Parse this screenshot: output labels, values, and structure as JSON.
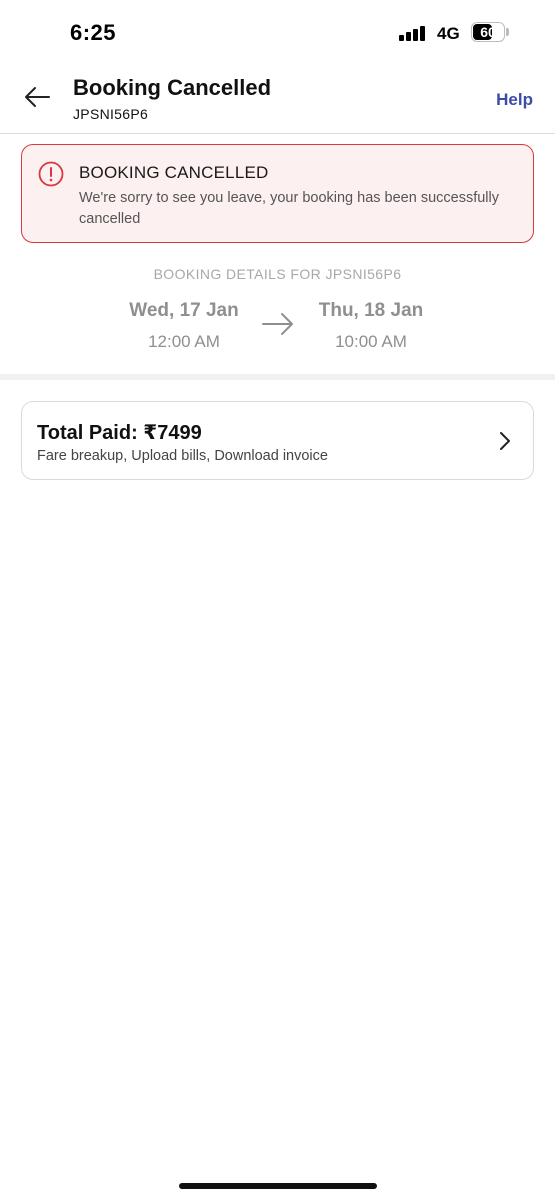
{
  "status_bar": {
    "time": "6:25",
    "network": "4G",
    "battery": "60",
    "battery_level": 0.6
  },
  "header": {
    "title": "Booking Cancelled",
    "booking_id": "JPSNI56P6",
    "help_label": "Help",
    "back_icon": "arrow-left-icon"
  },
  "alert": {
    "icon": "alert-circle-icon",
    "title": "BOOKING CANCELLED",
    "message": "We're sorry to see you leave, your booking has been successfully cancelled",
    "border_color": "#d9383f",
    "background_color": "#fdf0f0"
  },
  "booking_details": {
    "label": "BOOKING DETAILS FOR JPSNI56P6",
    "from": {
      "date": "Wed, 17 Jan",
      "time": "12:00 AM"
    },
    "to": {
      "date": "Thu, 18 Jan",
      "time": "10:00 AM"
    }
  },
  "payment": {
    "title": "Total Paid: ₹7499",
    "subtitle": "Fare breakup, Upload bills, Download invoice"
  },
  "colors": {
    "accent": "#3b4ba8",
    "danger": "#d9383f"
  }
}
